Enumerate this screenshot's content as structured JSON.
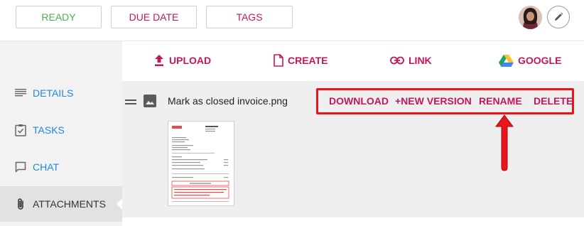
{
  "toolbar": {
    "ready_label": "READY",
    "due_date_label": "DUE DATE",
    "tags_label": "TAGS"
  },
  "sidebar": {
    "items": [
      {
        "label": "DETAILS",
        "icon": "details-lines-icon"
      },
      {
        "label": "TASKS",
        "icon": "clipboard-check-icon"
      },
      {
        "label": "CHAT",
        "icon": "chat-bubble-icon"
      },
      {
        "label": "ATTACHMENTS",
        "icon": "paperclip-icon",
        "active": true
      }
    ]
  },
  "actions": {
    "upload_label": "UPLOAD",
    "create_label": "CREATE",
    "link_label": "LINK",
    "google_label": "GOOGLE"
  },
  "attachment": {
    "filename": "Mark as closed invoice.png",
    "download_label": "DOWNLOAD",
    "new_version_label": "+NEW VERSION",
    "rename_label": "RENAME",
    "delete_label": "DELETE"
  },
  "colors": {
    "accent": "#c2185b",
    "ready": "#4caf50",
    "link_blue": "#1e88e5",
    "highlight_red": "#e8151b"
  }
}
